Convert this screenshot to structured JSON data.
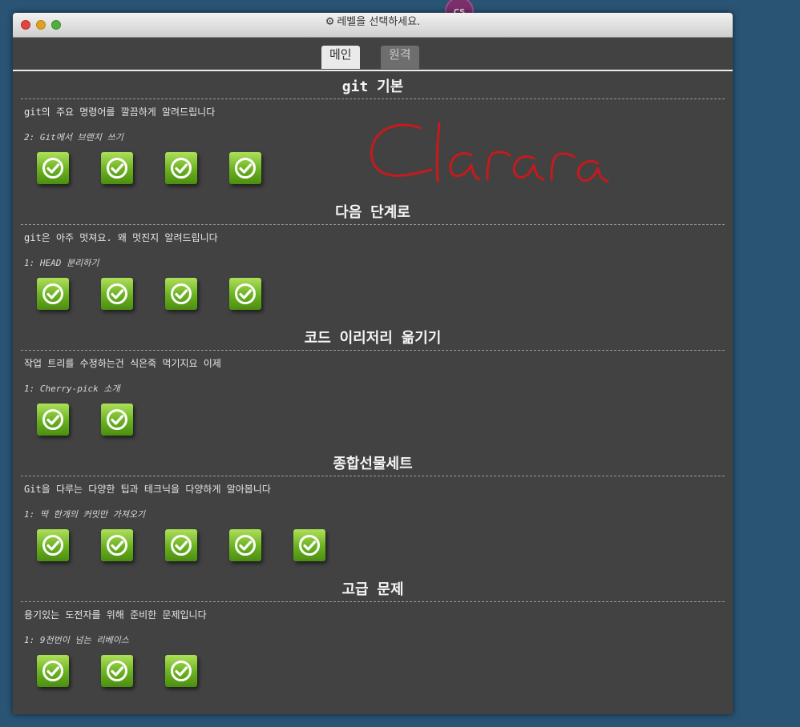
{
  "avatar": {
    "initials": "CS"
  },
  "window": {
    "title": "레벨을 선택하세요.",
    "tabs": [
      {
        "label": "메인",
        "active": true
      },
      {
        "label": "원격",
        "active": false
      }
    ]
  },
  "sections": [
    {
      "title": "git 기본",
      "about": "git의 주요 명령어를 깔끔하게 알려드립니다",
      "next": "2: Git에서 브랜치 쓰기",
      "levels": 4
    },
    {
      "title": "다음 단계로",
      "about": "git은 아주 멋져요. 왜 멋진지 알려드립니다",
      "next": "1: HEAD 분리하기",
      "levels": 4
    },
    {
      "title": "코드 이리저리 옮기기",
      "about": "작업 트리를 수정하는건 식은죽 먹기지요 이제",
      "next": "1: Cherry-pick 소개",
      "levels": 2
    },
    {
      "title": "종합선물세트",
      "about": "Git을 다루는 다양한 팁과 테크닉을 다양하게 알아봅니다",
      "next": "1: 딱 한개의 커밋만 가져오기",
      "levels": 5
    },
    {
      "title": "고급 문제",
      "about": "용기있는 도전자를 위해 준비한 문제입니다",
      "next": "1: 9천번이 넘는 리베이스",
      "levels": 3
    }
  ],
  "icons": {
    "title": "gear-icon",
    "level": "checkmark-icon"
  },
  "colors": {
    "level_green": "#69b120",
    "scribble": "#c8191c",
    "background": "#2a5474",
    "panel": "#424242"
  },
  "handwriting": "Clarara"
}
